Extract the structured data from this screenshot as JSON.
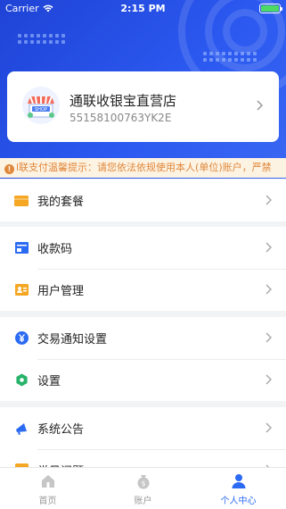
{
  "status_bar": {
    "carrier": "Carrier",
    "time": "2:15 PM"
  },
  "store": {
    "name": "通联收银宝直营店",
    "id": "55158100763YK2E",
    "badge": "SHOP"
  },
  "notice": {
    "text": "l联支付温馨提示：请您依法依规使用本人(单位)账户，严禁"
  },
  "menu": {
    "group1": [
      {
        "label": "我的套餐",
        "icon": "package-icon"
      }
    ],
    "group2": [
      {
        "label": "收款码",
        "icon": "payment-code-icon"
      },
      {
        "label": "用户管理",
        "icon": "user-management-icon"
      }
    ],
    "group3": [
      {
        "label": "交易通知设置",
        "icon": "yen-notification-icon"
      },
      {
        "label": "设置",
        "icon": "settings-icon"
      }
    ],
    "group4": [
      {
        "label": "系统公告",
        "icon": "megaphone-icon"
      },
      {
        "label": "常见问题",
        "icon": "question-icon"
      }
    ]
  },
  "tabs": [
    {
      "label": "首页",
      "icon": "home-icon",
      "active": false
    },
    {
      "label": "账户",
      "icon": "account-icon",
      "active": false
    },
    {
      "label": "个人中心",
      "icon": "profile-icon",
      "active": true
    }
  ],
  "colors": {
    "brand_blue": "#2b58ef",
    "active_tab": "#2b6af3",
    "notice_text": "#e0873a",
    "notice_bg": "#fdf3e3"
  }
}
